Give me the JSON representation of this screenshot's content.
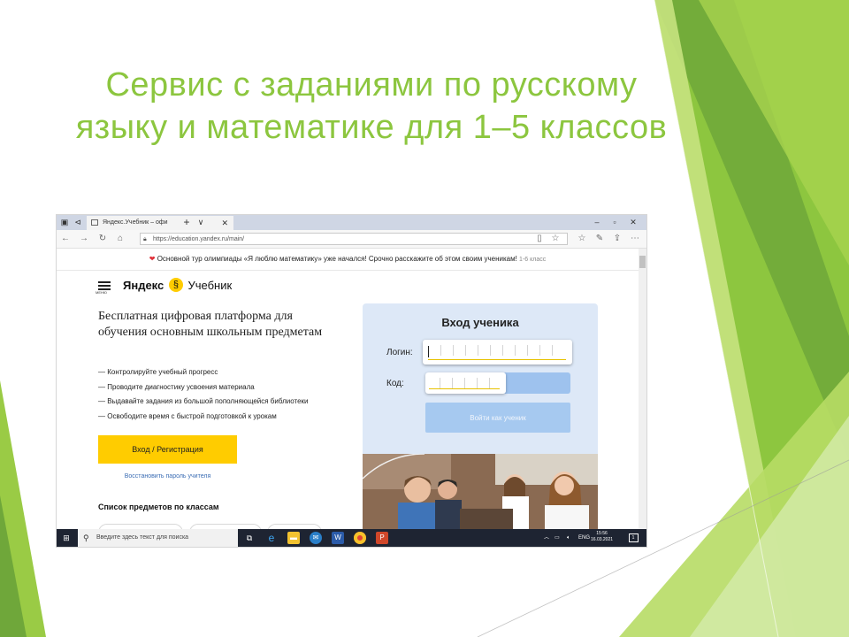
{
  "slide": {
    "title_line1": "Сервис с заданиями по русскому",
    "title_line2": "языку и математике для 1–5 классов"
  },
  "browser": {
    "tab_title": "Яндекс.Учебник – офи",
    "tab_close": "✕",
    "new_tab": "+",
    "tab_menu": "∨",
    "url": "https://education.yandex.ru/main/"
  },
  "page": {
    "notice": "Основной тур олимпиады «Я люблю математику» уже начался! Срочно расскажите об этом своим ученикам!",
    "notice_grade": "1-6 класс",
    "menu_label": "МЕНЮ",
    "logo_brand": "Яндекс",
    "logo_mark": "§",
    "logo_product": "Учебник",
    "headline": "Бесплатная цифровая платформа для обучения основным школьным предметам",
    "features": [
      "— Контролируйте учебный прогресс",
      "— Проводите диагностику усвоения материала",
      "— Выдавайте задания из большой пополняющейся библиотеки",
      "— Освободите время с быстрой подготовкой к урокам"
    ],
    "login_button": "Вход / Регистрация",
    "restore_link": "Восстановить пароль учителя",
    "subjects_heading": "Список предметов по классам"
  },
  "student_login": {
    "title": "Вход ученика",
    "login_label": "Логин:",
    "code_label": "Код:",
    "submit_label": "Войти как ученик"
  },
  "taskbar": {
    "search_placeholder": "Введите здесь текст для поиска",
    "language": "ENG",
    "time": "15:56",
    "date": "16.03.2021",
    "notifications_count": "1"
  },
  "colors": {
    "title_green": "#8cc63f",
    "yandex_yellow": "#ffcc00",
    "panel_blue": "#dde8f7",
    "button_blue": "#a6c9f0",
    "taskbar": "#1e2432"
  }
}
